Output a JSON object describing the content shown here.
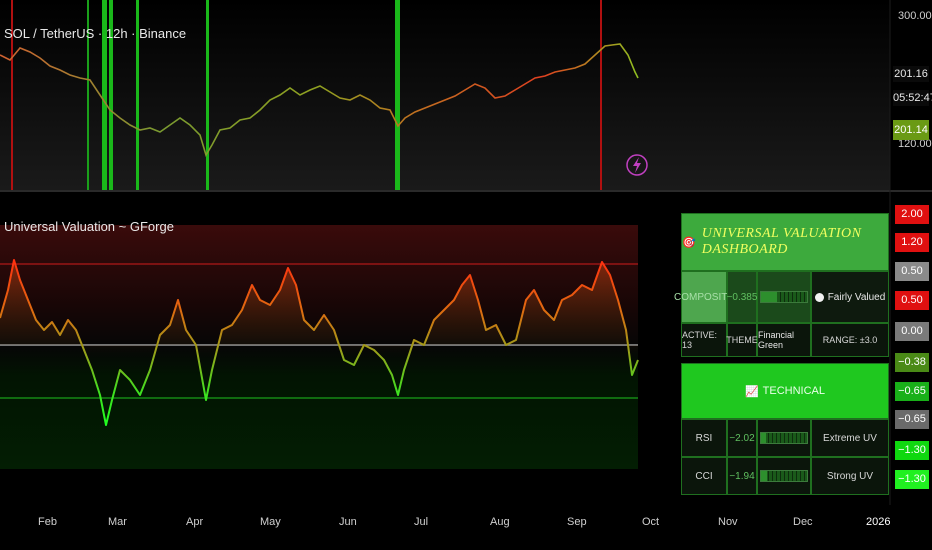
{
  "chart": {
    "symbol_title": "SOL / TetherUS · 12h · Binance",
    "indicator_title": "Universal Valuation ~ GForge"
  },
  "price_axis": {
    "top_label": "300.00",
    "low_label": "120.00",
    "last_price": "201.16",
    "countdown": "05:52:47",
    "current_tag": "201.14"
  },
  "time_axis": [
    "Feb",
    "Mar",
    "Apr",
    "May",
    "Jun",
    "Jul",
    "Aug",
    "Sep",
    "Oct",
    "Nov",
    "Dec",
    "2026"
  ],
  "indicator_axis": [
    {
      "label": "2.00",
      "color": "#e01010"
    },
    {
      "label": "1.20",
      "color": "#e01010"
    },
    {
      "label": "0.50",
      "color": "#8a8a8a"
    },
    {
      "label": "0.50",
      "color": "#e01010"
    },
    {
      "label": "0.00",
      "color": "#7a7a7a"
    },
    {
      "label": "−0.38",
      "color": "#4a8a16"
    },
    {
      "label": "−0.65",
      "color": "#19b019"
    },
    {
      "label": "−0.65",
      "color": "#6a6a6a"
    },
    {
      "label": "−1.30",
      "color": "#0fd80f"
    },
    {
      "label": "−1.30",
      "color": "#20f020"
    }
  ],
  "dashboard": {
    "title": "UNIVERSAL VALUATION DASHBOARD",
    "title_icon": "🎯",
    "composite_label": "COMPOSITE",
    "composite_value": "−0.385",
    "composite_status": "Fairly Valued",
    "active": "ACTIVE: 13",
    "theme_label": "THEME",
    "theme_value": "Financial Green",
    "range": "RANGE: ±3.0",
    "section_label": "TECHNICAL",
    "section_icon": "📈",
    "rows": [
      {
        "name": "RSI",
        "value": "−2.02",
        "status": "Extreme UV"
      },
      {
        "name": "CCI",
        "value": "−1.94",
        "status": "Strong UV"
      }
    ]
  },
  "colors": {
    "overvalued": "#e01010",
    "undervalued": "#10c010",
    "dashboard_green": "#23c623"
  },
  "icons": {
    "alert": "lightning-icon"
  }
}
